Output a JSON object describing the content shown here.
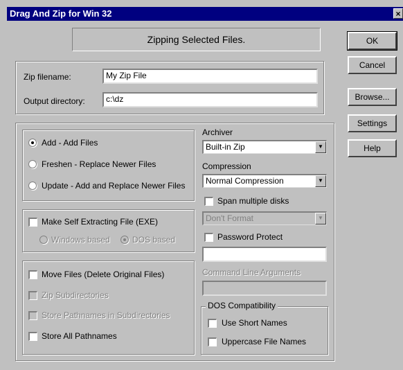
{
  "window": {
    "title": "Drag And Zip for Win 32",
    "close_glyph": "×"
  },
  "status": {
    "text": "Zipping Selected Files."
  },
  "fields": {
    "zip_filename_label": "Zip filename:",
    "zip_filename_value": "My Zip File",
    "output_dir_label": "Output directory:",
    "output_dir_value": "c:\\dz"
  },
  "buttons": {
    "ok": "OK",
    "cancel": "Cancel",
    "browse": "Browse...",
    "settings": "Settings",
    "help": "Help"
  },
  "mode": {
    "selected": "add",
    "options": [
      {
        "id": "add",
        "label": "Add - Add Files"
      },
      {
        "id": "freshen",
        "label": "Freshen - Replace Newer Files"
      },
      {
        "id": "update",
        "label": "Update - Add and Replace Newer Files"
      }
    ]
  },
  "self_extract": {
    "label": "Make Self Extracting File (EXE)",
    "checked": false,
    "windows_label": "Windows based",
    "dos_label": "DOS based",
    "selected": "dos"
  },
  "options": {
    "move_files": "Move Files (Delete Original Files)",
    "zip_subdirs": "Zip Subdirectories",
    "store_pathnames_subdirs": "Store Pathnames in Subdirectories",
    "store_all_pathnames": "Store All Pathnames"
  },
  "archiver": {
    "label": "Archiver",
    "value": "Built-in Zip",
    "compression_label": "Compression",
    "compression_value": "Normal Compression",
    "span_label": "Span multiple disks",
    "format_value": "Don't Format",
    "password_label": "Password Protect",
    "password_value": "",
    "cmdline_label": "Command Line Arguments",
    "cmdline_value": ""
  },
  "dos": {
    "group_label": "DOS Compatibility",
    "short_names": "Use Short Names",
    "uppercase": "Uppercase File Names"
  },
  "icons": {
    "close": "close-icon",
    "dropdown": "chevron-down-icon"
  },
  "colors": {
    "titlebar": "#000080",
    "face": "#c0c0c0",
    "disabled_text": "#808080"
  }
}
